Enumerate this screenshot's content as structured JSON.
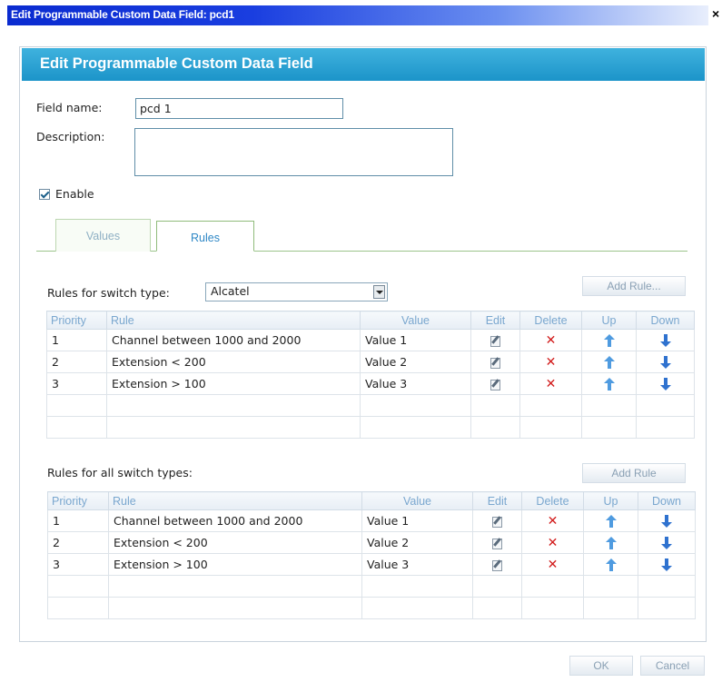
{
  "window": {
    "title": "Edit Programmable Custom Data Field: pcd1",
    "close_label": "×"
  },
  "dialog": {
    "header": "Edit Programmable Custom Data Field"
  },
  "form": {
    "field_name_label": "Field name:",
    "field_name_value": "pcd 1",
    "description_label": "Description:",
    "description_value": "",
    "enable_label": "Enable",
    "enable_checked": true
  },
  "tabs": [
    {
      "label": "Values",
      "active": false
    },
    {
      "label": "Rules",
      "active": true
    }
  ],
  "switch_rules": {
    "label": "Rules for switch type:",
    "selected_switch": "Alcatel",
    "add_button": "Add Rule..."
  },
  "all_rules": {
    "label": "Rules for all switch types:",
    "add_button": "Add Rule"
  },
  "columns": [
    "Priority",
    "Rule",
    "Value",
    "Edit",
    "Delete",
    "Up",
    "Down"
  ],
  "switch_table": [
    {
      "priority": "1",
      "rule": "Channel between 1000 and 2000",
      "value": "Value 1"
    },
    {
      "priority": "2",
      "rule": "Extension < 200",
      "value": "Value 2"
    },
    {
      "priority": "3",
      "rule": "Extension > 100",
      "value": "Value 3"
    }
  ],
  "all_table": [
    {
      "priority": "1",
      "rule": "Channel between 1000 and 2000",
      "value": "Value 1"
    },
    {
      "priority": "2",
      "rule": "Extension < 200",
      "value": "Value 2"
    },
    {
      "priority": "3",
      "rule": "Extension > 100",
      "value": "Value 3"
    }
  ],
  "footer": {
    "ok_label": "OK",
    "cancel_label": "Cancel"
  },
  "colors": {
    "header_blue": "#1c94c9",
    "title_blue": "#0a2bd0",
    "delete_red": "#d21c1c",
    "arrow_blue": "#2f72cf"
  }
}
